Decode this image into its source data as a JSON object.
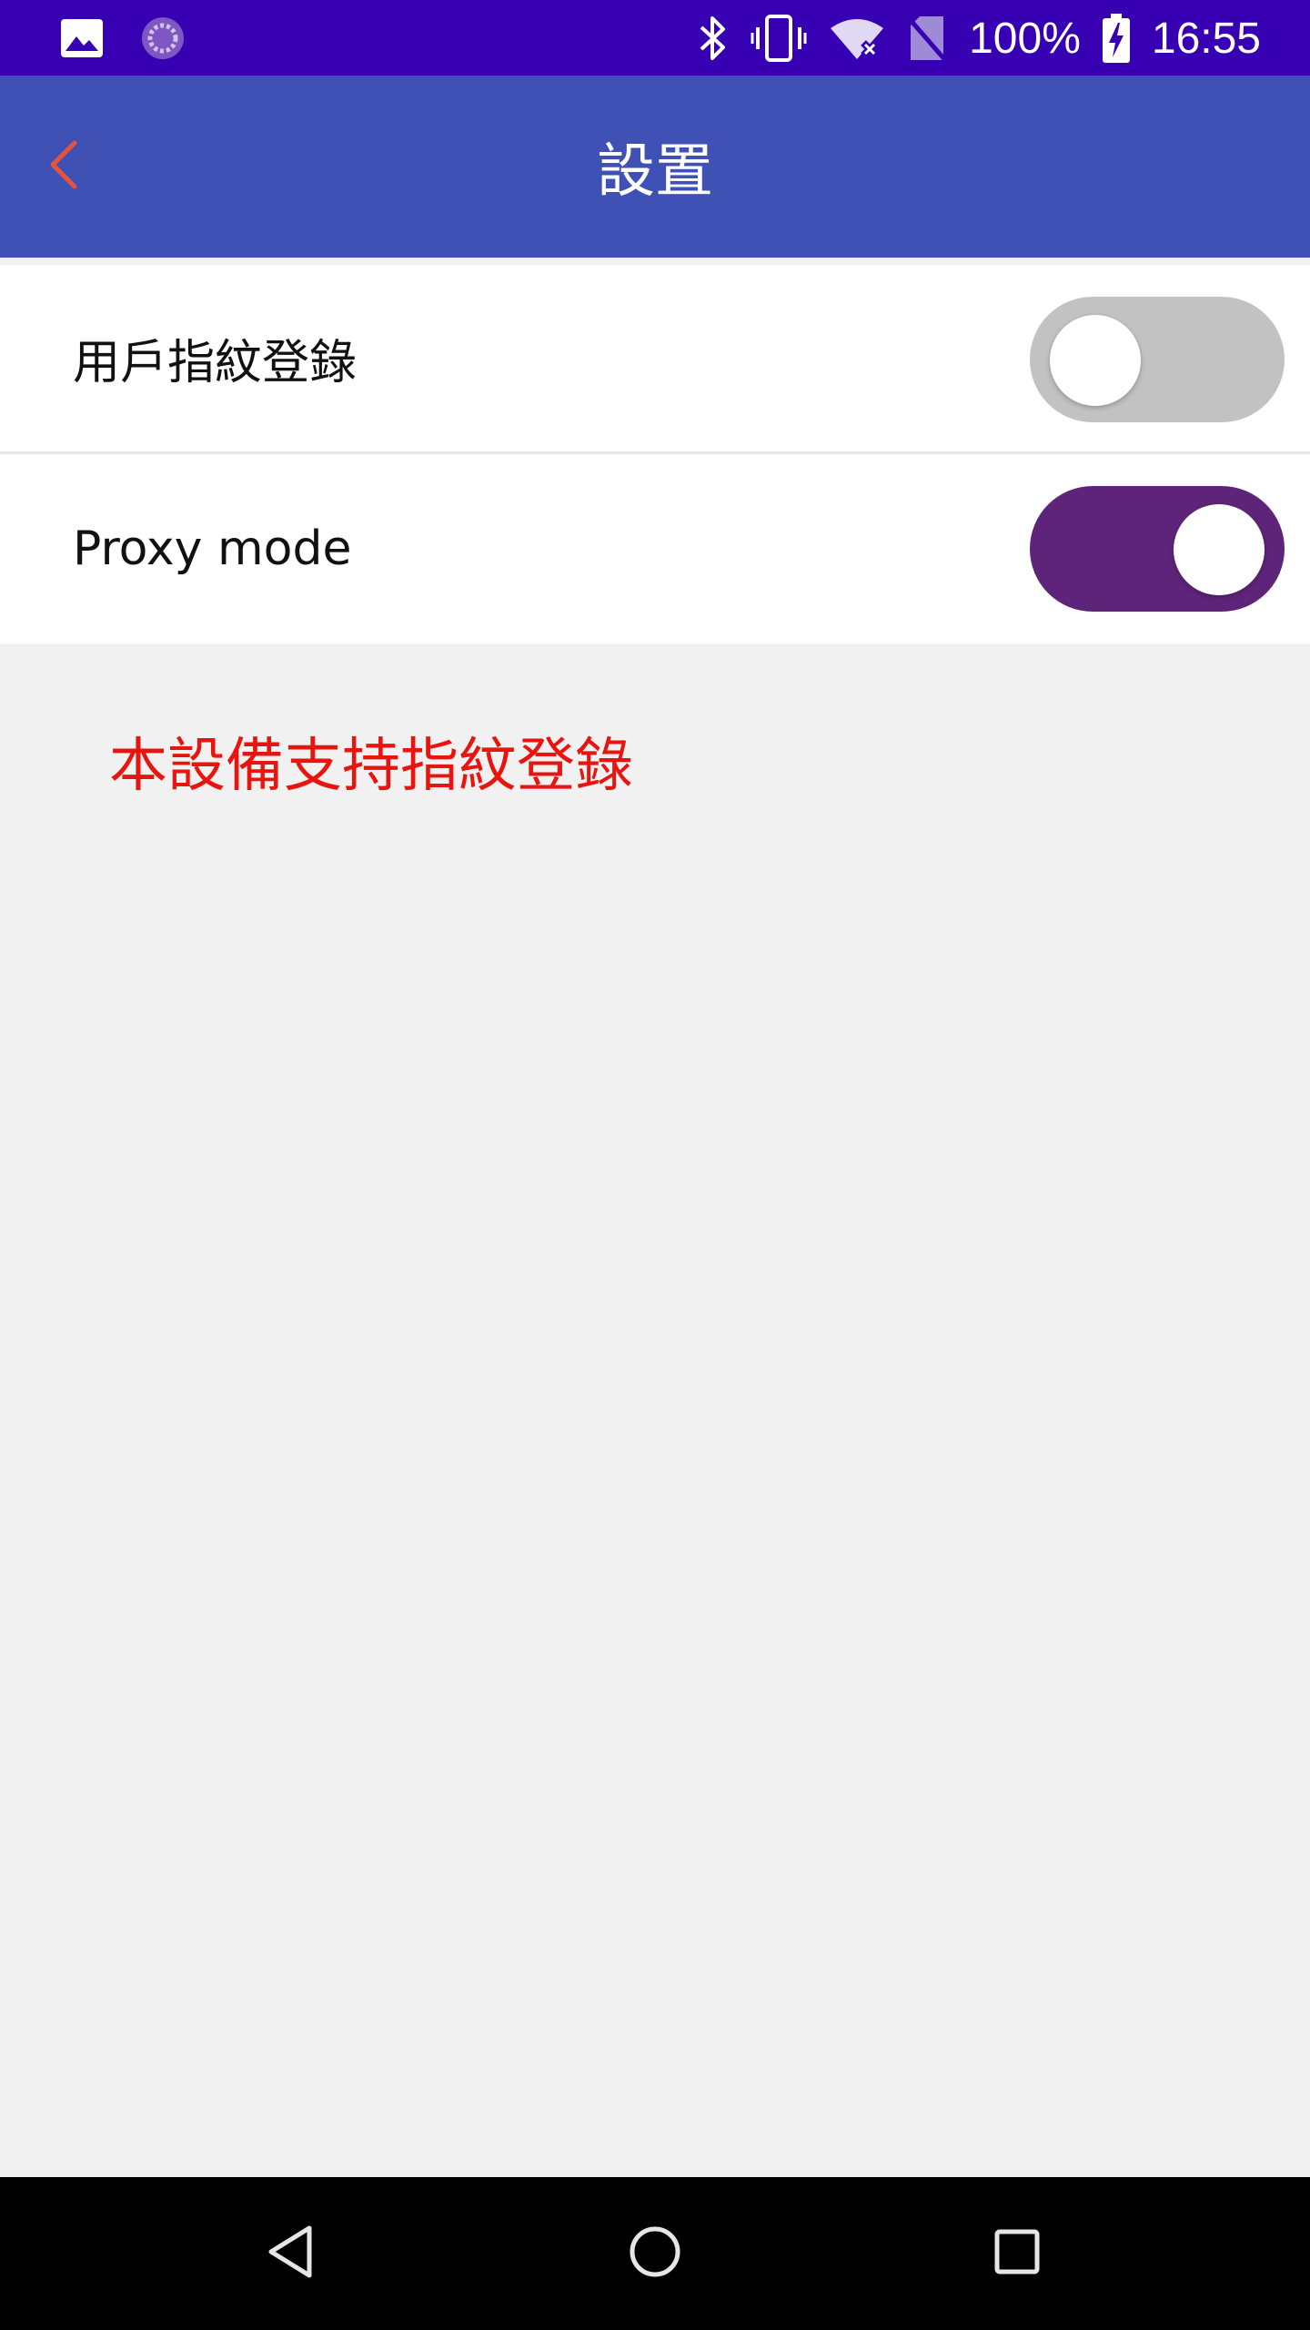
{
  "status_bar": {
    "battery_percent": "100%",
    "time": "16:55",
    "icons": [
      "image-icon",
      "sync-icon",
      "bluetooth-icon",
      "vibrate-icon",
      "wifi-off-icon",
      "no-sim-icon",
      "battery-charging-icon"
    ],
    "background_color": "#3700b3"
  },
  "app_bar": {
    "title": "設置",
    "back_icon": "chevron-left-icon",
    "background_color": "#3f51b5",
    "back_icon_color": "#e5533d"
  },
  "settings": {
    "items": [
      {
        "label": "用戶指紋登錄",
        "toggle_on": false
      },
      {
        "label": "Proxy mode",
        "toggle_on": true
      }
    ],
    "toggle_on_color": "#5e2479",
    "toggle_off_color": "#c2c2c2"
  },
  "info": {
    "message": "本設備支持指紋登錄",
    "color": "#e8140f"
  },
  "nav_bar": {
    "icons": [
      "back-triangle-icon",
      "home-circle-icon",
      "recents-square-icon"
    ]
  }
}
